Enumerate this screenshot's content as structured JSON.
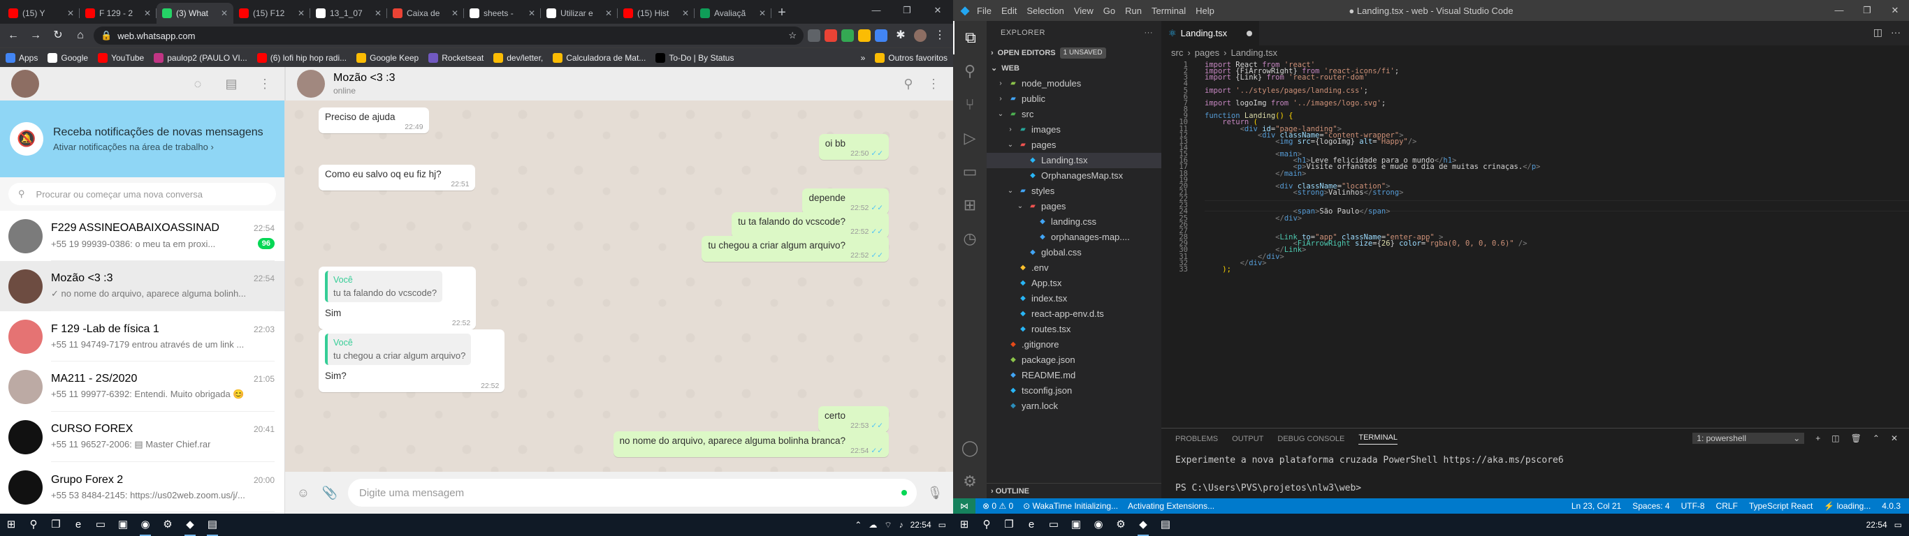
{
  "browser": {
    "tabs": [
      {
        "label": "(15) Y",
        "color": "#ff0000",
        "active": false
      },
      {
        "label": "F 129 - 2",
        "color": "#ff0000",
        "active": false
      },
      {
        "label": "(3) What",
        "color": "#25d366",
        "active": true
      },
      {
        "label": "(15) F12",
        "color": "#ff0000",
        "active": false
      },
      {
        "label": "13_1_07",
        "color": "#ffffff",
        "active": false
      },
      {
        "label": "Caixa de",
        "color": "#ea4335",
        "active": false
      },
      {
        "label": "sheets -",
        "color": "#ffffff",
        "active": false
      },
      {
        "label": "Utilizar e",
        "color": "#ffffff",
        "active": false
      },
      {
        "label": "(15) Hist",
        "color": "#ff0000",
        "active": false
      },
      {
        "label": "Avaliaçã",
        "color": "#0f9d58",
        "active": false
      }
    ],
    "new_tab": "+",
    "url": "web.whatsapp.com",
    "bookmarks": [
      {
        "label": "Apps",
        "color": "#4285f4"
      },
      {
        "label": "Google",
        "color": "#ffffff"
      },
      {
        "label": "YouTube",
        "color": "#ff0000"
      },
      {
        "label": "paulop2 (PAULO VI...",
        "color": "#c13584"
      },
      {
        "label": "(6) lofi hip hop radi...",
        "color": "#ff0000"
      },
      {
        "label": "Google Keep",
        "color": "#fbbc04"
      },
      {
        "label": "Rocketseat",
        "color": "#7159c1"
      },
      {
        "label": "dev/letter,",
        "color": "#fbbc04"
      },
      {
        "label": "Calculadora de Mat...",
        "color": "#fbbc04"
      },
      {
        "label": "To-Do | By Status",
        "color": "#000000"
      }
    ],
    "other_bookmarks": "Outros favoritos"
  },
  "whatsapp": {
    "notification": {
      "title": "Receba notificações de novas mensagens",
      "subtitle": "Ativar notificações na área de trabalho ›"
    },
    "search_placeholder": "Procurar ou começar uma nova conversa",
    "chats": [
      {
        "name": "F229 ASSINEOABAIXOASSINAD",
        "time": "22:54",
        "preview": "+55 19 99939-0386: o meu ta em proxi...",
        "badge": "96",
        "color": "#7b7b7b",
        "selected": false
      },
      {
        "name": "Mozão <3 :3",
        "time": "22:54",
        "preview": "✓ no nome do arquivo, aparece alguma bolinh...",
        "badge": "",
        "color": "#6d4c41",
        "selected": true
      },
      {
        "name": "F 129 -Lab de física 1",
        "time": "22:03",
        "preview": "+55 11 94749-7179 entrou através de um link ...",
        "badge": "",
        "color": "#e57373",
        "selected": false
      },
      {
        "name": "MA211 - 2S/2020",
        "time": "21:05",
        "preview": "+55 11 99977-6392: Entendi. Muito obrigada 😊",
        "badge": "",
        "color": "#bcaaa4",
        "selected": false
      },
      {
        "name": "CURSO FOREX",
        "time": "20:41",
        "preview": "+55 11 96527-2006: ▤ Master Chief.rar",
        "badge": "",
        "color": "#111111",
        "selected": false
      },
      {
        "name": "Grupo Forex 2",
        "time": "20:00",
        "preview": "+55 53 8484-2145: https://us02web.zoom.us/j/...",
        "badge": "",
        "color": "#111111",
        "selected": false
      }
    ],
    "contact": {
      "name": "Mozão <3 :3",
      "status": "online"
    },
    "messages": [
      {
        "text": "Preciso de ajuda",
        "time": "22:49",
        "dir": "in"
      },
      {
        "text": "oi bb",
        "time": "22:50",
        "dir": "out"
      },
      {
        "text": "Como eu salvo oq eu fiz hj?",
        "time": "22:51",
        "dir": "in"
      },
      {
        "text": "depende",
        "time": "22:52",
        "dir": "out"
      },
      {
        "text": "tu ta falando do vcscode?",
        "time": "22:52",
        "dir": "out"
      },
      {
        "text": "tu chegou a criar algum arquivo?",
        "time": "22:52",
        "dir": "out"
      },
      {
        "text": "Sim",
        "time": "22:52",
        "dir": "in",
        "quote_author": "Você",
        "quote_text": "tu ta falando do vcscode?"
      },
      {
        "text": "Sim?",
        "time": "22:52",
        "dir": "in",
        "quote_author": "Você",
        "quote_text": "tu chegou a criar algum arquivo?"
      },
      {
        "text": "certo",
        "time": "22:53",
        "dir": "out"
      },
      {
        "text": "no nome do arquivo, aparece alguma bolinha branca?",
        "time": "22:54",
        "dir": "out"
      }
    ],
    "compose_placeholder": "Digite uma mensagem"
  },
  "vscode": {
    "menu": [
      "File",
      "Edit",
      "Selection",
      "View",
      "Go",
      "Run",
      "Terminal",
      "Help"
    ],
    "title": "● Landing.tsx - web - Visual Studio Code",
    "explorer_title": "EXPLORER",
    "open_editors": "OPEN EDITORS",
    "unsaved": "1 UNSAVED",
    "project": "WEB",
    "tree": [
      {
        "label": "node_modules",
        "indent": 1,
        "type": "folder",
        "arrow": "›",
        "color": "#8bc34a"
      },
      {
        "label": "public",
        "indent": 1,
        "type": "folder",
        "arrow": "›",
        "color": "#42a5f5"
      },
      {
        "label": "src",
        "indent": 1,
        "type": "folder",
        "arrow": "⌄",
        "color": "#4caf50"
      },
      {
        "label": "images",
        "indent": 2,
        "type": "folder",
        "arrow": "›",
        "color": "#26a69a"
      },
      {
        "label": "pages",
        "indent": 2,
        "type": "folder",
        "arrow": "⌄",
        "color": "#ef5350"
      },
      {
        "label": "Landing.tsx",
        "indent": 3,
        "type": "file",
        "arrow": "",
        "color": "#29b6f6",
        "active": true
      },
      {
        "label": "OrphanagesMap.tsx",
        "indent": 3,
        "type": "file",
        "arrow": "",
        "color": "#29b6f6"
      },
      {
        "label": "styles",
        "indent": 2,
        "type": "folder",
        "arrow": "⌄",
        "color": "#42a5f5"
      },
      {
        "label": "pages",
        "indent": 3,
        "type": "folder",
        "arrow": "⌄",
        "color": "#ef5350"
      },
      {
        "label": "landing.css",
        "indent": 4,
        "type": "file",
        "arrow": "",
        "color": "#42a5f5"
      },
      {
        "label": "orphanages-map....",
        "indent": 4,
        "type": "file",
        "arrow": "",
        "color": "#42a5f5"
      },
      {
        "label": "global.css",
        "indent": 3,
        "type": "file",
        "arrow": "",
        "color": "#42a5f5"
      },
      {
        "label": ".env",
        "indent": 2,
        "type": "file",
        "arrow": "",
        "color": "#fbc02d"
      },
      {
        "label": "App.tsx",
        "indent": 2,
        "type": "file",
        "arrow": "",
        "color": "#29b6f6"
      },
      {
        "label": "index.tsx",
        "indent": 2,
        "type": "file",
        "arrow": "",
        "color": "#29b6f6"
      },
      {
        "label": "react-app-env.d.ts",
        "indent": 2,
        "type": "file",
        "arrow": "",
        "color": "#29b6f6"
      },
      {
        "label": "routes.tsx",
        "indent": 2,
        "type": "file",
        "arrow": "",
        "color": "#29b6f6"
      },
      {
        "label": ".gitignore",
        "indent": 1,
        "type": "file",
        "arrow": "",
        "color": "#e64a19"
      },
      {
        "label": "package.json",
        "indent": 1,
        "type": "file",
        "arrow": "",
        "color": "#8bc34a"
      },
      {
        "label": "README.md",
        "indent": 1,
        "type": "file",
        "arrow": "",
        "color": "#42a5f5"
      },
      {
        "label": "tsconfig.json",
        "indent": 1,
        "type": "file",
        "arrow": "",
        "color": "#29b6f6"
      },
      {
        "label": "yarn.lock",
        "indent": 1,
        "type": "file",
        "arrow": "",
        "color": "#2c8ebb"
      }
    ],
    "outline": "OUTLINE",
    "tab_label": "Landing.tsx",
    "breadcrumb": [
      "src",
      "pages",
      "Landing.tsx"
    ],
    "code_lines": [
      [
        [
          "kc",
          "import "
        ],
        [
          "",
          "React "
        ],
        [
          "kc",
          "from "
        ],
        [
          "st",
          "'react'"
        ]
      ],
      [
        [
          "kc",
          "import "
        ],
        [
          "",
          "{FiArrowRight} "
        ],
        [
          "kc",
          "from "
        ],
        [
          "st",
          "'react-icons/fi'"
        ],
        [
          "",
          ";"
        ]
      ],
      [
        [
          "kc",
          "import "
        ],
        [
          "",
          "{Link} "
        ],
        [
          "kc",
          "from "
        ],
        [
          "st",
          "'react-router-dom'"
        ]
      ],
      [],
      [
        [
          "kc",
          "import "
        ],
        [
          "st",
          "'../styles/pages/landing.css'"
        ],
        [
          "",
          ";"
        ]
      ],
      [],
      [
        [
          "kc",
          "import "
        ],
        [
          "",
          "logoImg "
        ],
        [
          "kc",
          "from "
        ],
        [
          "st",
          "'../images/logo.svg'"
        ],
        [
          "",
          ";"
        ]
      ],
      [],
      [
        [
          "kw",
          "function "
        ],
        [
          "fn",
          "Landing"
        ],
        [
          "br",
          "() {"
        ]
      ],
      [
        [
          "",
          "    "
        ],
        [
          "kc",
          "return "
        ],
        [
          "br",
          "("
        ]
      ],
      [
        [
          "",
          "        "
        ],
        [
          "pn",
          "<"
        ],
        [
          "tg",
          "div "
        ],
        [
          "at",
          "id"
        ],
        [
          "",
          "="
        ],
        [
          "st",
          "\"page-landing\""
        ],
        [
          "pn",
          ">"
        ]
      ],
      [
        [
          "",
          "            "
        ],
        [
          "pn",
          "<"
        ],
        [
          "tg",
          "div "
        ],
        [
          "at",
          "className"
        ],
        [
          "",
          "="
        ],
        [
          "st",
          "\"content-wrapper\""
        ],
        [
          "pn",
          ">"
        ]
      ],
      [
        [
          "",
          "                "
        ],
        [
          "pn",
          "<"
        ],
        [
          "tg",
          "img "
        ],
        [
          "at",
          "src"
        ],
        [
          "",
          "={logoImg} "
        ],
        [
          "at",
          "alt"
        ],
        [
          "",
          "="
        ],
        [
          "st",
          "\"Happy\""
        ],
        [
          "pn",
          "/>"
        ]
      ],
      [],
      [
        [
          "",
          "                "
        ],
        [
          "pn",
          "<"
        ],
        [
          "tg",
          "main"
        ],
        [
          "pn",
          ">"
        ]
      ],
      [
        [
          "",
          "                    "
        ],
        [
          "pn",
          "<"
        ],
        [
          "tg",
          "h1"
        ],
        [
          "pn",
          ">"
        ],
        [
          "",
          "Leve felicidade para o mundo"
        ],
        [
          "pn",
          "</"
        ],
        [
          "tg",
          "h1"
        ],
        [
          "pn",
          ">"
        ]
      ],
      [
        [
          "",
          "                    "
        ],
        [
          "pn",
          "<"
        ],
        [
          "tg",
          "p"
        ],
        [
          "pn",
          ">"
        ],
        [
          "",
          "Visite orfanatos e mude o dia de muitas crinaças."
        ],
        [
          "pn",
          "</"
        ],
        [
          "tg",
          "p"
        ],
        [
          "pn",
          ">"
        ]
      ],
      [
        [
          "",
          "                "
        ],
        [
          "pn",
          "</"
        ],
        [
          "tg",
          "main"
        ],
        [
          "pn",
          ">"
        ]
      ],
      [],
      [
        [
          "",
          "                "
        ],
        [
          "pn",
          "<"
        ],
        [
          "tg",
          "div "
        ],
        [
          "at",
          "className"
        ],
        [
          "",
          "="
        ],
        [
          "st",
          "\"location\""
        ],
        [
          "pn",
          ">"
        ]
      ],
      [
        [
          "",
          "                    "
        ],
        [
          "pn",
          "<"
        ],
        [
          "tg",
          "strong"
        ],
        [
          "pn",
          ">"
        ],
        [
          "",
          "Valinhos"
        ],
        [
          "pn",
          "</"
        ],
        [
          "tg",
          "strong"
        ],
        [
          "pn",
          ">"
        ]
      ],
      [],
      [
        [
          "",
          "                    "
        ]
      ],
      [
        [
          "",
          "                    "
        ],
        [
          "pn",
          "<"
        ],
        [
          "tg",
          "span"
        ],
        [
          "pn",
          ">"
        ],
        [
          "",
          "São Paulo"
        ],
        [
          "pn",
          "</"
        ],
        [
          "tg",
          "span"
        ],
        [
          "pn",
          ">"
        ]
      ],
      [
        [
          "",
          "                "
        ],
        [
          "pn",
          "</"
        ],
        [
          "tg",
          "div"
        ],
        [
          "pn",
          ">"
        ]
      ],
      [],
      [],
      [
        [
          "",
          "                "
        ],
        [
          "pn",
          "<"
        ],
        [
          "cm",
          "Link "
        ],
        [
          "at",
          "to"
        ],
        [
          "",
          "="
        ],
        [
          "st",
          "\"app\" "
        ],
        [
          "at",
          "className"
        ],
        [
          "",
          "="
        ],
        [
          "st",
          "\"enter-app\" "
        ],
        [
          "pn",
          ">"
        ]
      ],
      [
        [
          "",
          "                    "
        ],
        [
          "pn",
          "<"
        ],
        [
          "cm",
          "FiArrowRight "
        ],
        [
          "at",
          "size"
        ],
        [
          "",
          "={"
        ],
        [
          "fn",
          "26"
        ],
        [
          "",
          "} "
        ],
        [
          "at",
          "color"
        ],
        [
          "",
          "="
        ],
        [
          "st",
          "\"rgba(0, 0, 0, 0.6)\" "
        ],
        [
          "pn",
          "/>"
        ]
      ],
      [
        [
          "",
          "                "
        ],
        [
          "pn",
          "</"
        ],
        [
          "cm",
          "Link"
        ],
        [
          "pn",
          ">"
        ]
      ],
      [
        [
          "",
          "            "
        ],
        [
          "pn",
          "</"
        ],
        [
          "tg",
          "div"
        ],
        [
          "pn",
          ">"
        ]
      ],
      [
        [
          "",
          "        "
        ],
        [
          "pn",
          "</"
        ],
        [
          "tg",
          "div"
        ],
        [
          "pn",
          ">"
        ]
      ],
      [
        [
          "",
          "    "
        ],
        [
          "br",
          ");"
        ]
      ]
    ],
    "panel_tabs": [
      "PROBLEMS",
      "OUTPUT",
      "DEBUG CONSOLE",
      "TERMINAL"
    ],
    "terminal_select": "1: powershell",
    "terminal_lines": [
      "Experimente a nova plataforma cruzada PowerShell https://aka.ms/pscore6",
      "",
      "PS C:\\Users\\PVS\\projetos\\nlw3\\web>"
    ],
    "status_left": [
      "⊗ 0  ⚠ 0",
      "⊙ WakaTime Initializing...",
      "Activating Extensions..."
    ],
    "status_right": [
      "Ln 23, Col 21",
      "Spaces: 4",
      "UTF-8",
      "CRLF",
      "TypeScript React",
      "⚡ loading...",
      "4.0.3"
    ]
  },
  "taskbar": {
    "time": "22:54"
  }
}
